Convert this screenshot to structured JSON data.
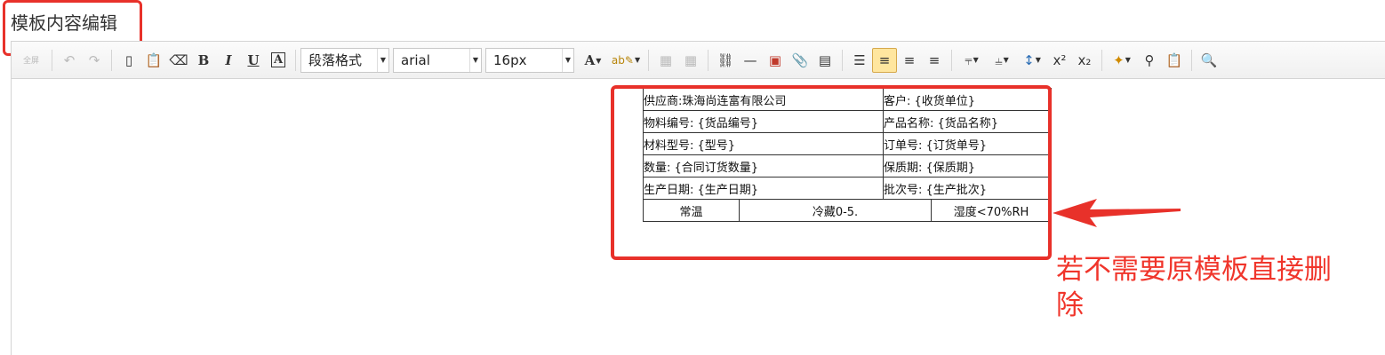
{
  "page": {
    "title": "模板内容编辑"
  },
  "toolbar": {
    "fullscreen_label": "全屏",
    "paragraph_format": "段落格式",
    "font_family": "arial",
    "font_size": "16px"
  },
  "template_table": {
    "rows": [
      [
        "供应商:珠海尚连富有限公司",
        "客户: {收货单位}"
      ],
      [
        "物料编号: {货品编号}",
        "产品名称: {货品名称}"
      ],
      [
        "材料型号: {型号}",
        "订单号: {订货单号}"
      ],
      [
        "数量: {合同订货数量}",
        "保质期: {保质期}"
      ],
      [
        "生产日期: {生产日期}",
        "批次号: {生产批次}"
      ]
    ],
    "bottom_row": [
      "常温",
      "冷藏0-5.",
      "湿度<70%RH"
    ]
  },
  "annotation": {
    "note": "若不需要原模板直接删除",
    "highlight_color": "#e8312a"
  }
}
